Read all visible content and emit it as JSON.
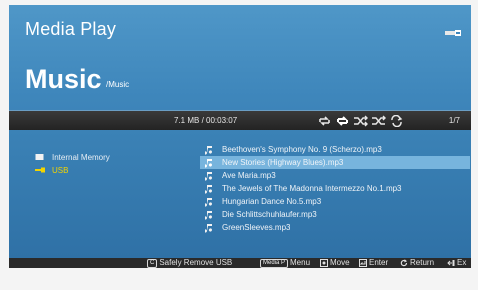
{
  "header": {
    "app_title": "Media Play",
    "section_title": "Music",
    "section_path": "/Music"
  },
  "status": {
    "size_time": "7.1 MB / 00:03:07",
    "page": "1/7",
    "modes": [
      "repeat-all-icon",
      "repeat-one-icon",
      "shuffle-icon",
      "shuffle-repeat-icon",
      "repeat-icon"
    ]
  },
  "sources": [
    {
      "label": "Internal Memory",
      "icon": "memory-card-icon",
      "selected": false
    },
    {
      "label": "USB",
      "icon": "usb-icon",
      "selected": true
    }
  ],
  "files": [
    {
      "label": "Beethoven's Symphony No. 9 (Scherzo).mp3",
      "selected": false
    },
    {
      "label": "New Stories (Highway Blues).mp3",
      "selected": true
    },
    {
      "label": "Ave Maria.mp3",
      "selected": false
    },
    {
      "label": "The Jewels of The Madonna Intermezzo No.1.mp3",
      "selected": false
    },
    {
      "label": "Hungarian Dance No.5.mp3",
      "selected": false
    },
    {
      "label": "Die Schlittschuhlaufer.mp3",
      "selected": false
    },
    {
      "label": "GreenSleeves.mp3",
      "selected": false
    }
  ],
  "hints": {
    "remove_key": "C",
    "remove_label": "Safely Remove USB",
    "menu_key": "Media P",
    "menu_label": "Menu",
    "move_label": "Move",
    "enter_label": "Enter",
    "return_label": "Return",
    "exit_label": "Ex"
  },
  "colors": {
    "accent_selected_text": "#f2d400",
    "highlight_row": "#77b4dd",
    "panel_blue": "#3b82b6"
  }
}
